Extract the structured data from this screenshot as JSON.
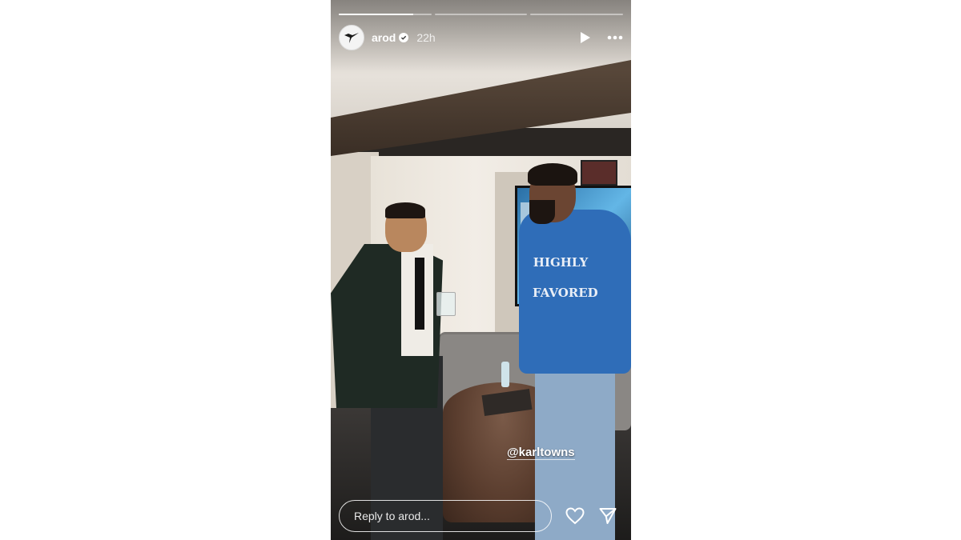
{
  "story": {
    "segments": [
      {
        "progress": 0.8
      },
      {
        "progress": 0
      },
      {
        "progress": 0
      }
    ],
    "user": {
      "username": "arod",
      "verified": true,
      "time_ago": "22h"
    },
    "media": {
      "hoodie_text_line1": "HIGHLY",
      "hoodie_text_line2": "FAVORED"
    },
    "mention": "@karltowns",
    "reply": {
      "placeholder": "Reply to arod..."
    }
  },
  "icons": {
    "avatar": "arod-logo-icon",
    "verified": "verified-badge-icon",
    "play": "play-icon",
    "more": "more-options-icon",
    "like": "heart-icon",
    "share": "send-icon"
  },
  "colors": {
    "verified_badge": "#ffffff",
    "overlay_text": "#ffffff"
  }
}
